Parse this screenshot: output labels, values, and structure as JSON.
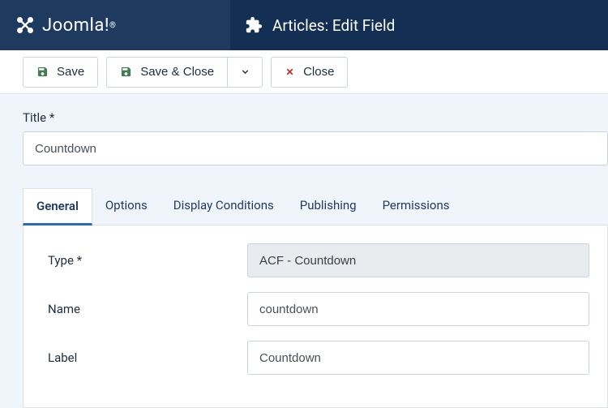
{
  "brand": "Joomla!",
  "page_title": "Articles: Edit Field",
  "toolbar": {
    "save": "Save",
    "save_close": "Save & Close",
    "close": "Close"
  },
  "title_field": {
    "label": "Title *",
    "value": "Countdown"
  },
  "tabs": [
    "General",
    "Options",
    "Display Conditions",
    "Publishing",
    "Permissions"
  ],
  "active_tab": 0,
  "general": {
    "type_label": "Type *",
    "type_value": "ACF - Countdown",
    "name_label": "Name",
    "name_value": "countdown",
    "label_label": "Label",
    "label_value": "Countdown"
  }
}
